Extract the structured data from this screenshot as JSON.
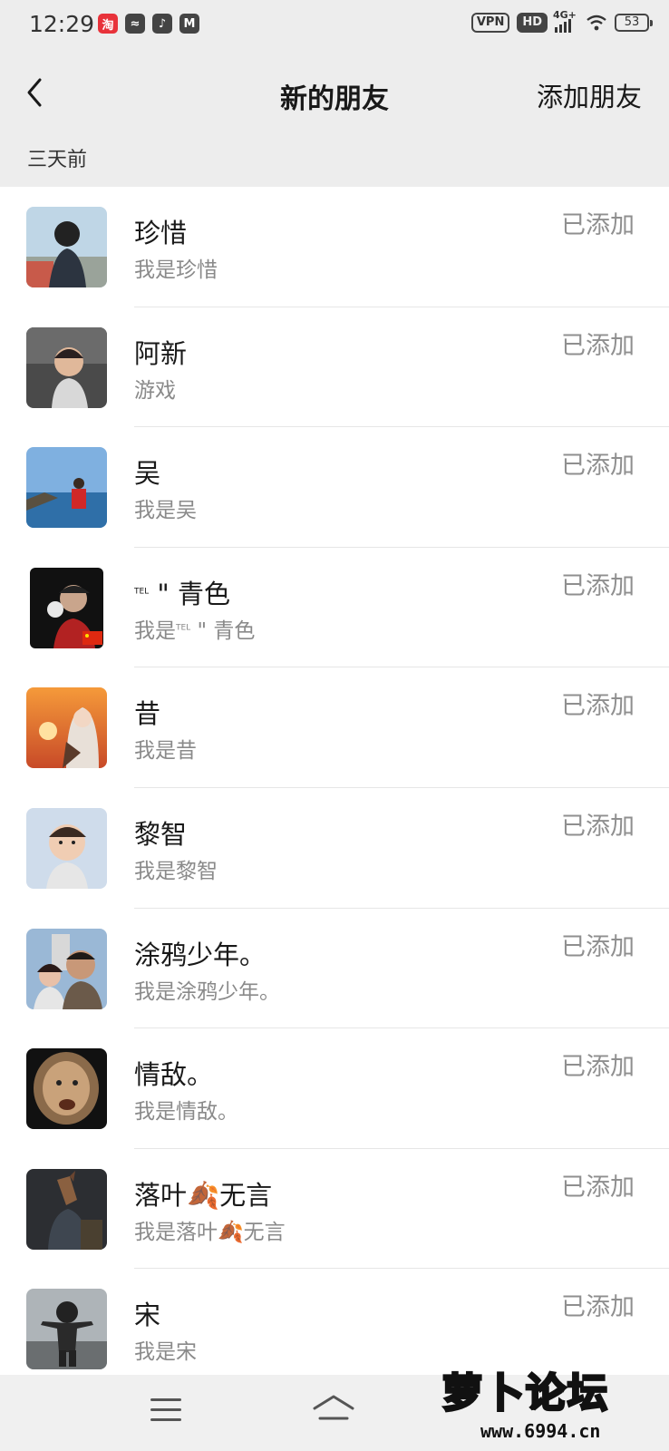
{
  "status_bar": {
    "time": "12:29",
    "vpn": "VPN",
    "hd": "HD",
    "network": "4G+",
    "battery": "53"
  },
  "nav": {
    "title": "新的朋友",
    "action": "添加朋友"
  },
  "section": {
    "label": "三天前"
  },
  "contacts": [
    {
      "name": "珍惜",
      "message": "我是珍惜",
      "status": "已添加"
    },
    {
      "name": "阿新",
      "message": "游戏",
      "status": "已添加"
    },
    {
      "name": "吴",
      "message": "我是吴",
      "status": "已添加"
    },
    {
      "name_prefix": "TEL",
      "name": " \" 青色",
      "message_prefix": "我是",
      "message_tel": "TEL",
      "message": " \" 青色",
      "status": "已添加"
    },
    {
      "name": "昔",
      "message": "我是昔",
      "status": "已添加"
    },
    {
      "name": "黎智",
      "message": "我是黎智",
      "status": "已添加"
    },
    {
      "name": "涂鸦少年。",
      "message": "我是涂鸦少年。",
      "status": "已添加"
    },
    {
      "name": "情敌。",
      "message": "我是情敌。",
      "status": "已添加"
    },
    {
      "name": "落叶🍂无言",
      "message": "我是落叶🍂无言",
      "status": "已添加"
    },
    {
      "name": "宋",
      "message": "我是宋",
      "status": "已添加"
    }
  ],
  "watermark": {
    "title": "萝卜论坛",
    "url": "www.6994.cn"
  },
  "colors": {
    "background": "#ededed",
    "list_bg": "#ffffff",
    "secondary_text": "#8a8a8a"
  }
}
